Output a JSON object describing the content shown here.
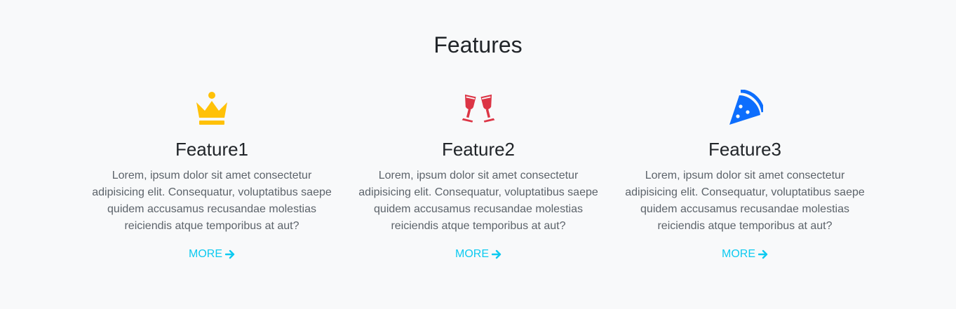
{
  "section": {
    "title": "Features"
  },
  "features": [
    {
      "title": "Feature1",
      "text": "Lorem, ipsum dolor sit amet consectetur adipisicing elit. Consequatur, voluptatibus saepe quidem accusamus recusandae molestias reiciendis atque temporibus at aut?",
      "link_label": "MORE",
      "icon": "crown-icon",
      "icon_color": "#ffc107"
    },
    {
      "title": "Feature2",
      "text": "Lorem, ipsum dolor sit amet consectetur adipisicing elit. Consequatur, voluptatibus saepe quidem accusamus recusandae molestias reiciendis atque temporibus at aut?",
      "link_label": "MORE",
      "icon": "wine-glasses-icon",
      "icon_color": "#dc3545"
    },
    {
      "title": "Feature3",
      "text": "Lorem, ipsum dolor sit amet consectetur adipisicing elit. Consequatur, voluptatibus saepe quidem accusamus recusandae molestias reiciendis atque temporibus at aut?",
      "link_label": "MORE",
      "icon": "pizza-icon",
      "icon_color": "#0d6efd"
    }
  ],
  "colors": {
    "link": "#0dcaf0",
    "background": "#f8f9fa"
  }
}
